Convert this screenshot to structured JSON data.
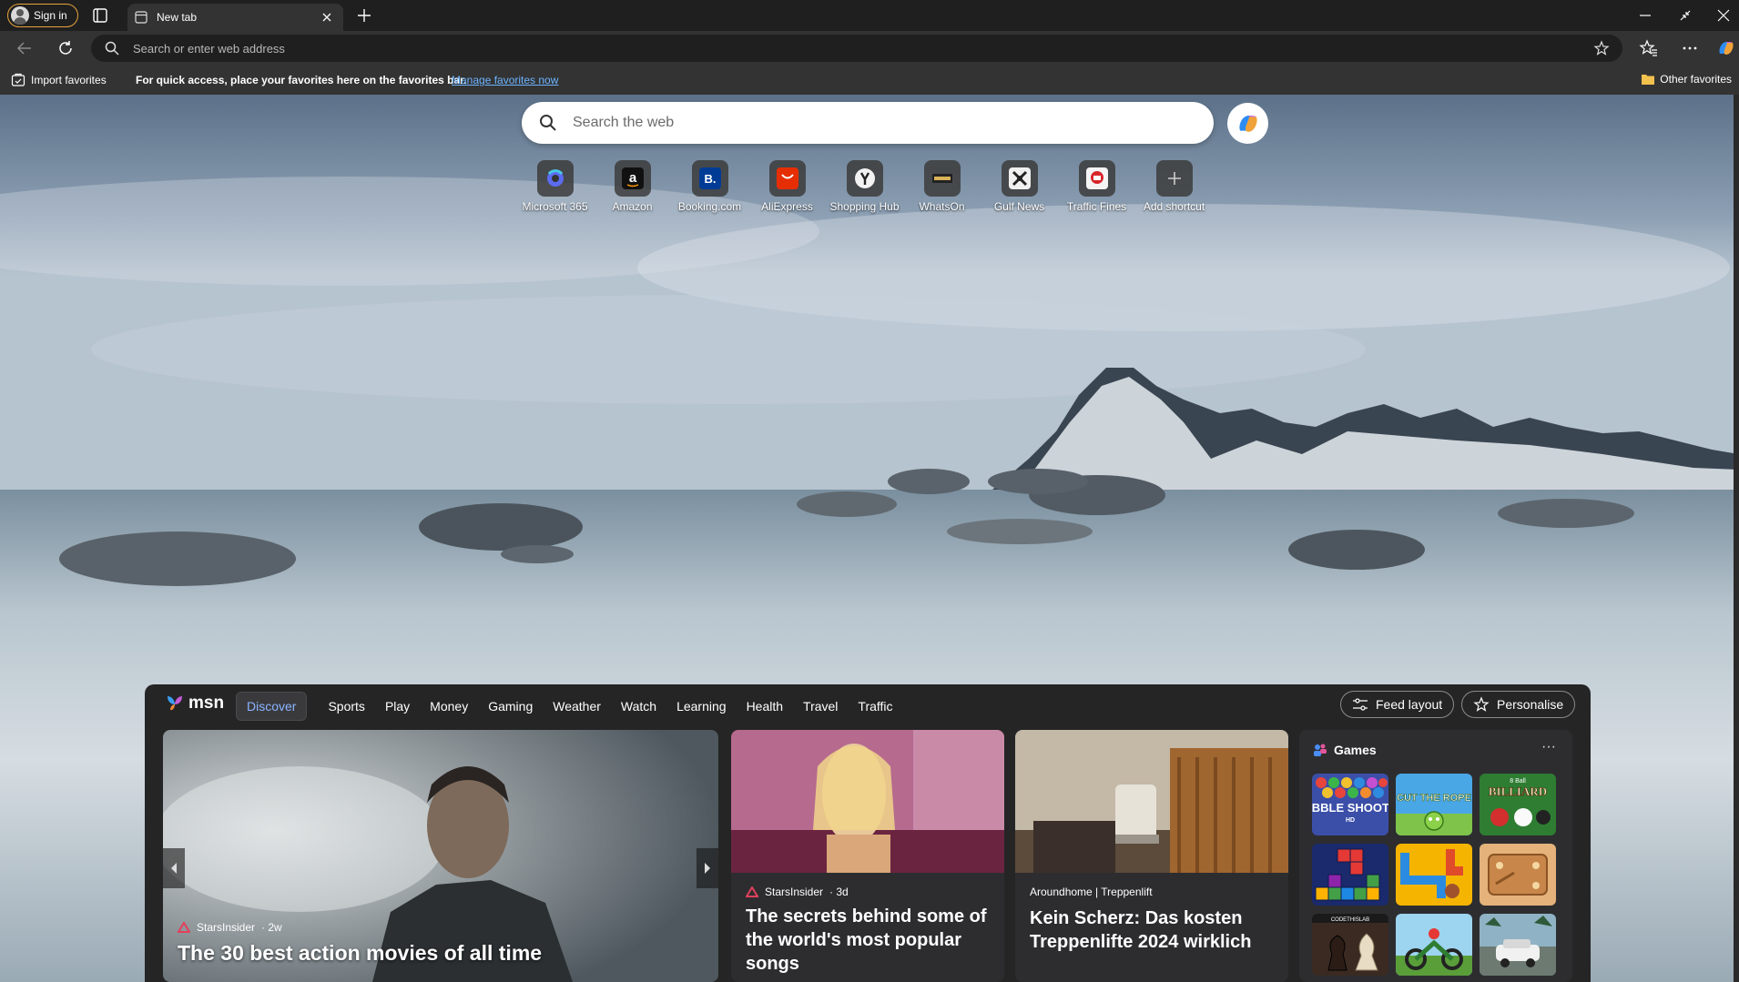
{
  "titlebar": {
    "signin_label": "Sign in",
    "tab_title": "New tab"
  },
  "addressbar": {
    "placeholder": "Search or enter web address"
  },
  "favorites_bar": {
    "import_label": "Import favorites",
    "message": "For quick access, place your favorites here on the favorites bar.",
    "manage_link": "Manage favorites now",
    "other_label": "Other favorites"
  },
  "newtab": {
    "search_placeholder": "Search the web",
    "shortcuts": [
      {
        "label": "Microsoft 365",
        "icon": "microsoft-365-icon"
      },
      {
        "label": "Amazon",
        "icon": "amazon-icon"
      },
      {
        "label": "Booking.com",
        "icon": "booking-icon"
      },
      {
        "label": "AliExpress",
        "icon": "aliexpress-icon"
      },
      {
        "label": "Shopping Hub",
        "icon": "shopping-hub-icon"
      },
      {
        "label": "WhatsOn",
        "icon": "whatson-icon"
      },
      {
        "label": "Gulf News",
        "icon": "gulf-news-icon"
      },
      {
        "label": "Traffic Fines",
        "icon": "traffic-fines-icon"
      },
      {
        "label": "Add shortcut",
        "icon": "plus-icon"
      }
    ]
  },
  "feed": {
    "logo": "msn",
    "tabs": [
      "Discover",
      "Sports",
      "Play",
      "Money",
      "Gaming",
      "Weather",
      "Watch",
      "Learning",
      "Health",
      "Travel",
      "Traffic"
    ],
    "active_tab": "Discover",
    "feed_layout_label": "Feed layout",
    "personalise_label": "Personalise",
    "cards": [
      {
        "source": "StarsInsider",
        "age": "· 2w",
        "headline": "The 30 best action movies of all time"
      },
      {
        "source": "StarsInsider",
        "age": "· 3d",
        "headline": "The secrets behind some of the world's most popular songs"
      },
      {
        "source": "Aroundhome | Treppenlift",
        "age": "",
        "headline": "Kein Scherz: Das kosten Treppenlifte 2024 wirklich"
      }
    ],
    "games": {
      "title": "Games",
      "more": "···",
      "tiles": [
        {
          "name": "BUBBLE SHOOTER",
          "sub": "HD"
        },
        {
          "name": "CUT THE ROPE",
          "sub": ""
        },
        {
          "name": "BILLIARD",
          "sub": "8 Ball"
        },
        {
          "name": "",
          "sub": ""
        },
        {
          "name": "",
          "sub": ""
        },
        {
          "name": "",
          "sub": ""
        },
        {
          "name": "CODETHISLAB",
          "sub": ""
        },
        {
          "name": "",
          "sub": ""
        },
        {
          "name": "",
          "sub": ""
        }
      ]
    }
  },
  "colors": {
    "accent_link": "#6cb4ff",
    "active_tab_text": "#8ab4ff",
    "signin_border": "#e8a33d"
  }
}
